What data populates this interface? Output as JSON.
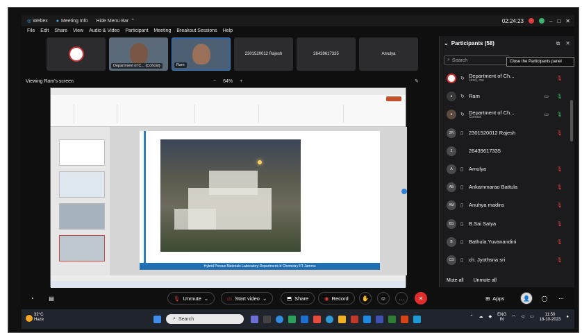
{
  "titlebar": {
    "app_name": "Webex",
    "meeting_info": "Meeting Info",
    "hide_menu": "Hide Menu Bar",
    "timer": "02:24:23"
  },
  "menu": [
    "File",
    "Edit",
    "Share",
    "View",
    "Audio & Video",
    "Participant",
    "Meeting",
    "Breakout Sessions",
    "Help"
  ],
  "thumbnails": [
    {
      "label": ""
    },
    {
      "label": "Department of C... (Cohost)"
    },
    {
      "label": "Ram"
    },
    {
      "label": "2301520012 Rajesh"
    },
    {
      "label": "26439617335"
    },
    {
      "label": "Amulya"
    }
  ],
  "viewing": "Viewing Ram's screen",
  "zoom": {
    "minus": "−",
    "value": "64%",
    "plus": "+"
  },
  "slide": {
    "footer": "Hybrid Porous Materials Laboratory-Department of Chemistry-IIT Jammu"
  },
  "panel": {
    "title": "Participants (58)",
    "search_placeholder": "Search",
    "tooltip": "Close the Participants panel",
    "mute_all": "Mute all",
    "unmute_all": "Unmute all"
  },
  "participants": [
    {
      "initials": "",
      "name": "Department of Ch...",
      "sub": "Host, me"
    },
    {
      "initials": "",
      "name": "Ram",
      "sub": ""
    },
    {
      "initials": "",
      "name": "Department of Ch...",
      "sub": "Cohost"
    },
    {
      "initials": "2R",
      "name": "2301520012 Rajesh",
      "sub": ""
    },
    {
      "initials": "2",
      "name": "26439617335",
      "sub": ""
    },
    {
      "initials": "A",
      "name": "Amulya",
      "sub": ""
    },
    {
      "initials": "AB",
      "name": "Ankammarao Battula",
      "sub": ""
    },
    {
      "initials": "AM",
      "name": "Anuhya madira",
      "sub": ""
    },
    {
      "initials": "BS",
      "name": "B.Sai Satya",
      "sub": ""
    },
    {
      "initials": "B",
      "name": "Bathula.Yuvanandini",
      "sub": ""
    },
    {
      "initials": "CS",
      "name": "ch. Jyothsna sri",
      "sub": ""
    }
  ],
  "controls": {
    "unmute": "Unmute",
    "start_video": "Start video",
    "share": "Share",
    "record": "Record",
    "apps": "Apps"
  },
  "taskbar": {
    "temp": "32°C",
    "weather": "Haze",
    "search": "Search",
    "lang": "ENG",
    "region": "IN",
    "time": "11:50",
    "date": "18-10-2023"
  },
  "colors": {
    "end_red": "#e22d2d",
    "mic_red": "#e04040",
    "accent_blue": "#2f7fd6"
  }
}
